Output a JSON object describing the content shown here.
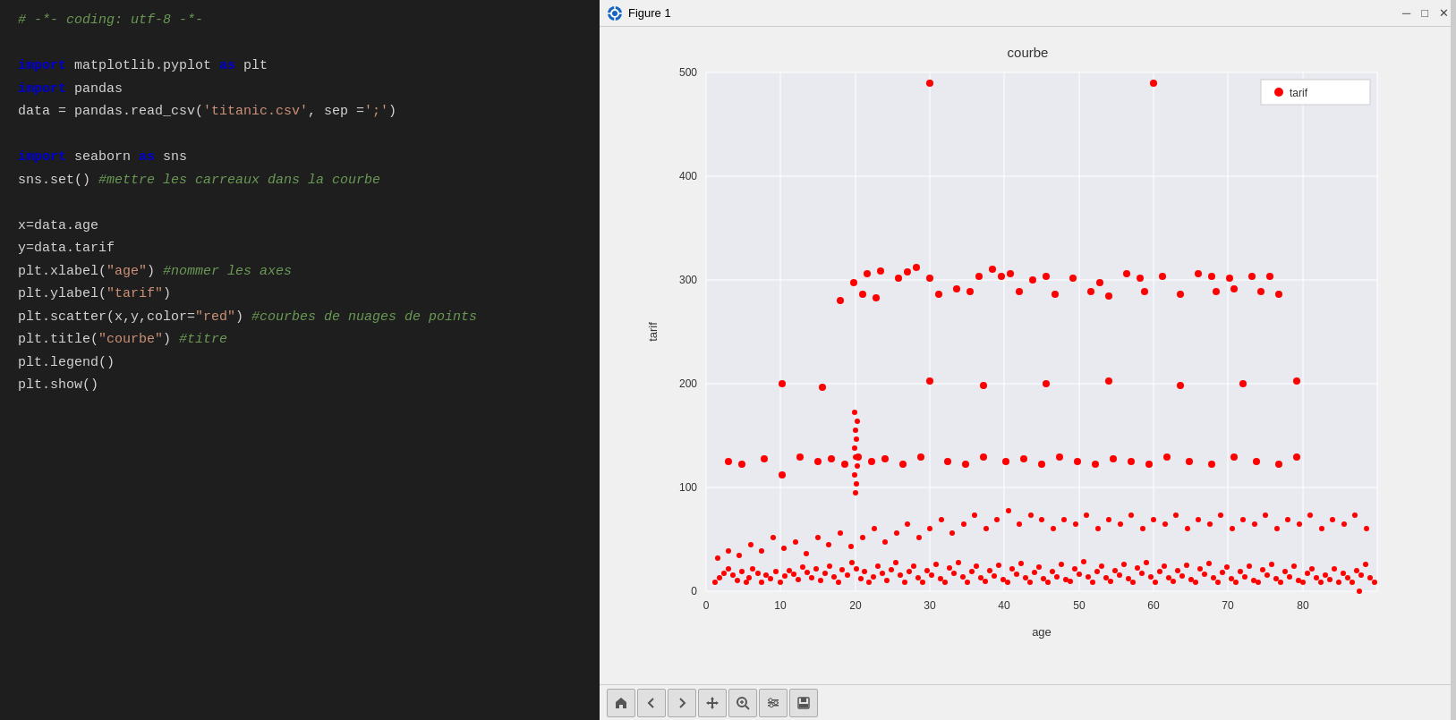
{
  "code_panel": {
    "lines": [
      {
        "id": "l1",
        "parts": [
          {
            "text": "# -*- coding: utf-8 -*-",
            "cls": "c-comment"
          }
        ]
      },
      {
        "id": "l2",
        "parts": []
      },
      {
        "id": "l3",
        "parts": [
          {
            "text": "import",
            "cls": "c-keyword"
          },
          {
            "text": " matplotlib.pyplot ",
            "cls": "c-normal"
          },
          {
            "text": "as",
            "cls": "c-keyword"
          },
          {
            "text": " plt",
            "cls": "c-normal"
          }
        ]
      },
      {
        "id": "l4",
        "parts": [
          {
            "text": "import",
            "cls": "c-keyword"
          },
          {
            "text": " pandas",
            "cls": "c-normal"
          }
        ]
      },
      {
        "id": "l5",
        "parts": [
          {
            "text": "data = pandas.read_csv(",
            "cls": "c-normal"
          },
          {
            "text": "'titanic.csv'",
            "cls": "c-string"
          },
          {
            "text": ", sep =",
            "cls": "c-normal"
          },
          {
            "text": "';'",
            "cls": "c-string"
          },
          {
            "text": ")",
            "cls": "c-normal"
          }
        ]
      },
      {
        "id": "l6",
        "parts": []
      },
      {
        "id": "l7",
        "parts": [
          {
            "text": "import",
            "cls": "c-keyword"
          },
          {
            "text": " seaborn ",
            "cls": "c-normal"
          },
          {
            "text": "as",
            "cls": "c-keyword"
          },
          {
            "text": " sns",
            "cls": "c-normal"
          }
        ]
      },
      {
        "id": "l8",
        "parts": [
          {
            "text": "sns.set() ",
            "cls": "c-normal"
          },
          {
            "text": "#mettre les carreaux dans la courbe",
            "cls": "c-comment"
          }
        ]
      },
      {
        "id": "l9",
        "parts": []
      },
      {
        "id": "l10",
        "parts": [
          {
            "text": "x=data.age",
            "cls": "c-normal"
          }
        ]
      },
      {
        "id": "l11",
        "parts": [
          {
            "text": "y=data.tarif",
            "cls": "c-normal"
          }
        ]
      },
      {
        "id": "l12",
        "parts": [
          {
            "text": "plt.xlabel(",
            "cls": "c-normal"
          },
          {
            "text": "\"age\"",
            "cls": "c-string"
          },
          {
            "text": ") ",
            "cls": "c-normal"
          },
          {
            "text": "#nommer les axes",
            "cls": "c-comment"
          }
        ]
      },
      {
        "id": "l13",
        "parts": [
          {
            "text": "plt.ylabel(",
            "cls": "c-normal"
          },
          {
            "text": "\"tarif\"",
            "cls": "c-string"
          },
          {
            "text": ")",
            "cls": "c-normal"
          }
        ]
      },
      {
        "id": "l14",
        "parts": [
          {
            "text": "plt.scatter(x,y,color=",
            "cls": "c-normal"
          },
          {
            "text": "\"red\"",
            "cls": "c-string"
          },
          {
            "text": ") ",
            "cls": "c-normal"
          },
          {
            "text": "#courbes de nuages de points",
            "cls": "c-comment"
          }
        ]
      },
      {
        "id": "l15",
        "parts": [
          {
            "text": "plt.title(",
            "cls": "c-normal"
          },
          {
            "text": "\"courbe\"",
            "cls": "c-string"
          },
          {
            "text": ") ",
            "cls": "c-normal"
          },
          {
            "text": "#titre",
            "cls": "c-comment"
          }
        ]
      },
      {
        "id": "l16",
        "parts": [
          {
            "text": "plt.legend()",
            "cls": "c-normal"
          }
        ]
      },
      {
        "id": "l17",
        "parts": [
          {
            "text": "plt.show()",
            "cls": "c-normal"
          }
        ]
      }
    ]
  },
  "figure": {
    "title": "Figure 1",
    "chart_title": "courbe",
    "x_label": "age",
    "y_label": "tarif",
    "legend_label": "tarif",
    "accent_color": "#ff0000",
    "bg_color": "#e8eaf0",
    "y_ticks": [
      0,
      100,
      200,
      300,
      400,
      500
    ],
    "x_ticks": [
      0,
      10,
      20,
      30,
      40,
      50,
      60,
      70,
      80
    ],
    "toolbar_buttons": [
      "home",
      "back",
      "forward",
      "move",
      "zoom",
      "settings",
      "save"
    ]
  }
}
